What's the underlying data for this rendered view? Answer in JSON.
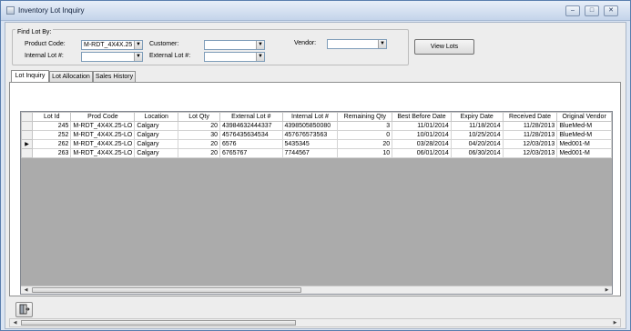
{
  "window": {
    "title": "Inventory Lot Inquiry",
    "minimize": "–",
    "maximize": "□",
    "close": "✕"
  },
  "find": {
    "legend": "Find Lot By:",
    "product_code_label": "Product Code:",
    "product_code_value": "M-RDT_4X4X.25",
    "internal_lot_label": "Internal Lot #:",
    "internal_lot_value": "",
    "customer_label": "Customer:",
    "customer_value": "",
    "external_lot_label": "External Lot #:",
    "external_lot_value": "",
    "vendor_label": "Vendor:",
    "vendor_value": ""
  },
  "view_lots_label": "View Lots",
  "tabs": [
    {
      "label": "Lot Inquiry",
      "active": true
    },
    {
      "label": "Lot Allocation",
      "active": false
    },
    {
      "label": "Sales History",
      "active": false
    }
  ],
  "grid": {
    "columns": [
      "Lot Id",
      "Prod Code",
      "Location",
      "Lot Qty",
      "External Lot #",
      "Internal Lot #",
      "Remaining Qty",
      "Best Before Date",
      "Expiry Date",
      "Received Date",
      "Original Vendor"
    ],
    "rows": [
      {
        "selected": false,
        "cells": [
          "245",
          "M-RDT_4X4X.25-LO",
          "Calgary",
          "20",
          "43984632444337",
          "4398505850080",
          "3",
          "11/01/2014",
          "11/18/2014",
          "11/28/2013",
          "BlueMed-M"
        ]
      },
      {
        "selected": false,
        "cells": [
          "252",
          "M-RDT_4X4X.25-LO",
          "Calgary",
          "30",
          "4576435634534",
          "457676573563",
          "0",
          "10/01/2014",
          "10/25/2014",
          "11/28/2013",
          "BlueMed-M"
        ]
      },
      {
        "selected": true,
        "cells": [
          "262",
          "M-RDT_4X4X.25-LO",
          "Calgary",
          "20",
          "6576",
          "5435345",
          "20",
          "03/28/2014",
          "04/20/2014",
          "12/03/2013",
          "Med001-M"
        ]
      },
      {
        "selected": false,
        "cells": [
          "263",
          "M-RDT_4X4X.25-LO",
          "Calgary",
          "20",
          "6765767",
          "7744567",
          "10",
          "06/01/2014",
          "06/30/2014",
          "12/03/2013",
          "Med001-M"
        ]
      }
    ]
  },
  "icons": {
    "combo_arrow": "▼",
    "row_pointer": "▶",
    "scroll_left": "◀",
    "scroll_right": "▶",
    "exit": "exit-door-icon"
  },
  "colors": {
    "grid_background": "#ababab",
    "title_gradient_top": "#e7eef8",
    "title_gradient_bottom": "#c4d4ea"
  }
}
